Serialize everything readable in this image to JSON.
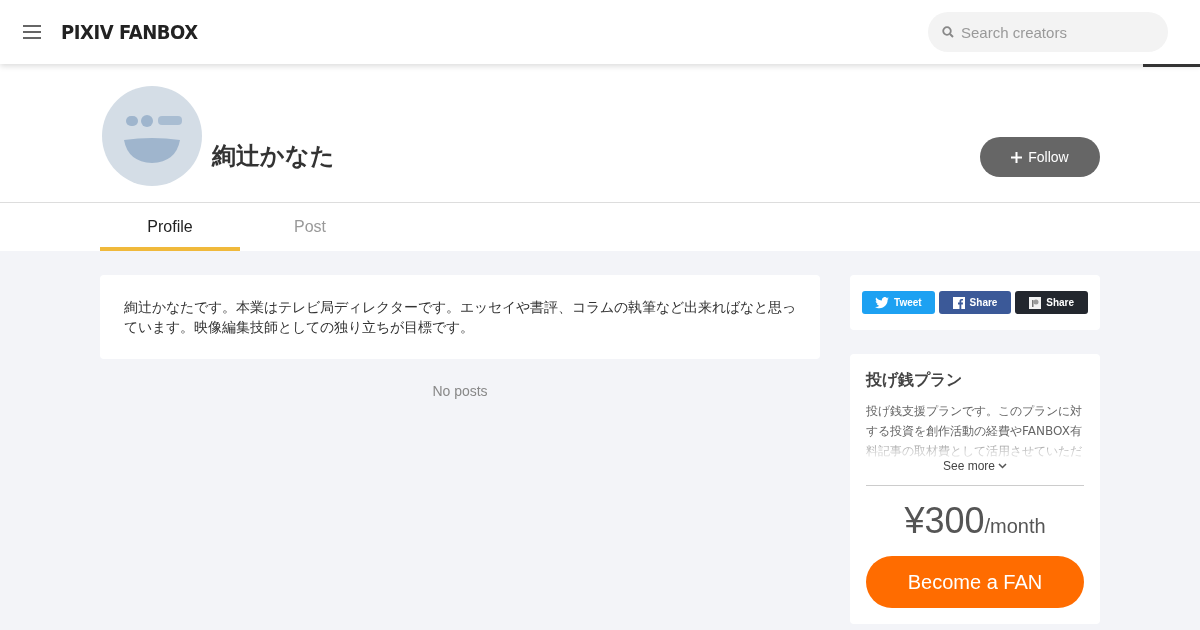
{
  "header": {
    "logo": "PIXIV FANBOX",
    "search": {
      "placeholder": "Search creators"
    }
  },
  "creator": {
    "name": "絢辻かなた",
    "follow_button": "Follow"
  },
  "tabs": [
    {
      "label": "Profile",
      "selected": true
    },
    {
      "label": "Post",
      "selected": false
    }
  ],
  "profile": {
    "bio": "絢辻かなたです。本業はテレビ局ディレクターです。エッセイや書評、コラムの執筆など出来ればなと思っています。映像編集技師としての独り立ちが目標です。",
    "empty_posts": "No posts"
  },
  "share_buttons": [
    {
      "kind": "twitter",
      "label": "Tweet"
    },
    {
      "kind": "facebook",
      "label": "Share"
    },
    {
      "kind": "pixiv",
      "label": "Share"
    }
  ],
  "plan": {
    "title": "投げ銭プラン",
    "description": "投げ銭支援プランです。このプランに対する投資を創作活動の経費やFANBOX有料記事の取材費として活用させていただ",
    "see_more": "See more",
    "price": "¥300",
    "period": "/month",
    "button": "Become a FAN"
  }
}
